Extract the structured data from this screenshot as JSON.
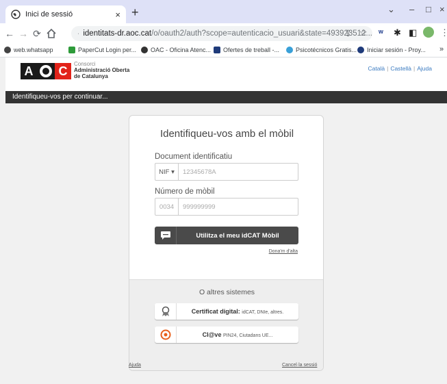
{
  "browser": {
    "tab_title": "Inici de sessió",
    "tab_close": "×",
    "new_tab": "+",
    "window_controls": [
      "⌄",
      "–",
      "□",
      "×"
    ],
    "url_host": "identitats-dr.aoc.cat",
    "url_path": "/o/oauth2/auth?scope=autenticacio_usuari&state=493923512..."
  },
  "bookmarks": [
    {
      "label": "web.whatsapp",
      "color": "#444444"
    },
    {
      "label": "PaperCut Login per...",
      "color": "#2e9b3a"
    },
    {
      "label": "OAC - Oficina Atenc...",
      "color": "#333333"
    },
    {
      "label": "Ofertes de treball -...",
      "color": "#1f3b7a"
    },
    {
      "label": "Psicotécnicos Gratis...",
      "color": "#3aa0d8"
    },
    {
      "label": "Iniciar sesión - Proy...",
      "color": "#1f3b7a"
    }
  ],
  "bookmarks_overflow": "»",
  "header": {
    "logo_letters": [
      "A",
      "O",
      "C"
    ],
    "logo_small": "Consorci",
    "logo_line1": "Administració Oberta",
    "logo_line2": "de Catalunya",
    "languages": [
      "Català",
      "Castellà",
      "Ajuda"
    ],
    "lang_sep": "|"
  },
  "banner": "Identifiqueu-vos per continuar...",
  "login": {
    "title": "Identifiqueu-vos amb el mòbil",
    "document_label": "Document identificatiu",
    "document_type": "NIF ▾",
    "document_placeholder": "12345678A",
    "phone_label": "Número de mòbil",
    "phone_prefix": "0034",
    "phone_placeholder": "999999999",
    "mobile_button": "Utilitza el meu idCAT Mòbil",
    "register_link": "Dona'm d'alta"
  },
  "other_systems": {
    "heading": "O altres sistemes",
    "cert_label": "Certificat digital:",
    "cert_desc": "idCAT, DNIe, altres.",
    "clave_label": "Cl@ve",
    "clave_desc": "PIN24, Ciutadans UE..."
  },
  "footer": {
    "help": "Ajuda",
    "cancel": "Cancel·la sessió"
  },
  "colors": {
    "logo_a": "#1a1a1a",
    "logo_o": "#1a1a1a",
    "logo_c": "#e2231a",
    "clave_orange": "#e8601c",
    "link_blue": "#3a7ac0"
  }
}
